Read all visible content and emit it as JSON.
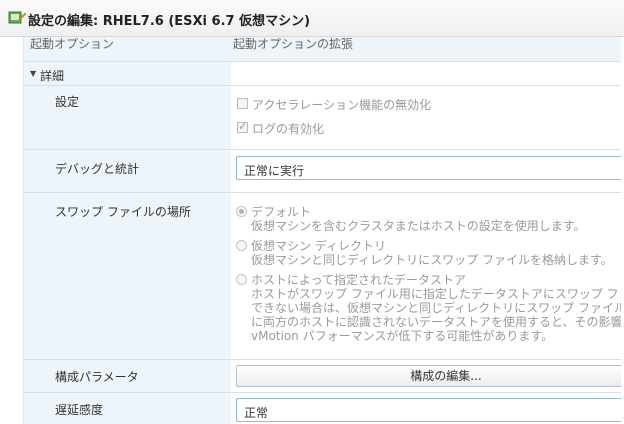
{
  "window": {
    "title": "設定の編集: RHEL7.6 (ESXi 6.7 仮想マシン)"
  },
  "cut_row": {
    "label": "起動オプション",
    "value": "起動オプションの拡張"
  },
  "details": {
    "title": "詳細"
  },
  "settings": {
    "label": "設定",
    "accel_label": "アクセラレーション機能の無効化",
    "accel_checked": false,
    "logging_label": "ログの有効化",
    "logging_checked": true
  },
  "debug": {
    "label": "デバッグと統計",
    "value": "正常に実行"
  },
  "swap": {
    "label": "スワップ ファイルの場所",
    "options": [
      {
        "title": "デフォルト",
        "lines": [
          "仮想マシンを含むクラスタまたはホストの設定を使用します。"
        ],
        "selected": true
      },
      {
        "title": "仮想マシン ディレクトリ",
        "lines": [
          "仮想マシンと同じディレクトリにスワップ ファイルを格納します。"
        ],
        "selected": false
      },
      {
        "title": "ホストによって指定されたデータストア",
        "lines": [
          "ホストがスワップ ファイル用に指定したデータストアにスワップ ファイルを格納しま",
          "できない場合は、仮想マシンと同じディレクトリにスワップ ファイルを格納します。v",
          "に両方のホストに認識されないデータストアを使用すると、その影響を受ける仮想",
          "vMotion パフォーマンスが低下する可能性があります。"
        ],
        "selected": false
      }
    ]
  },
  "config": {
    "label": "構成パラメータ",
    "button": "構成の編集..."
  },
  "latency": {
    "label": "遅延感度",
    "value": "正常"
  }
}
